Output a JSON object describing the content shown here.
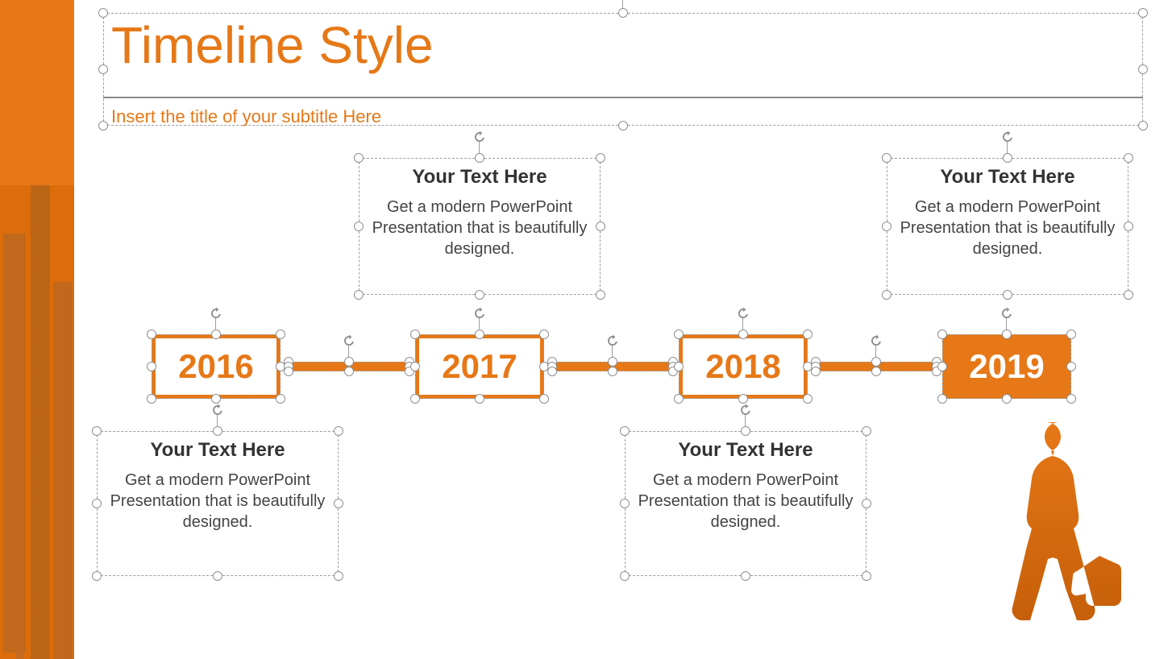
{
  "header": {
    "title": "Timeline Style",
    "subtitle": "Insert the title of your subtitle Here"
  },
  "timeline": {
    "years": [
      "2016",
      "2017",
      "2018",
      "2019"
    ],
    "callouts": [
      {
        "title": "Your Text  Here",
        "body": "Get a modern PowerPoint Presentation that is beautifully designed."
      },
      {
        "title": "Your Text  Here",
        "body": "Get a modern PowerPoint Presentation that is beautifully designed."
      },
      {
        "title": "Your Text  Here",
        "body": "Get a modern PowerPoint Presentation that is beautifully designed."
      },
      {
        "title": "Your Text  Here",
        "body": "Get a modern PowerPoint Presentation that is beautifully designed."
      }
    ]
  },
  "colors": {
    "accent": "#e67817",
    "text": "#333333"
  }
}
